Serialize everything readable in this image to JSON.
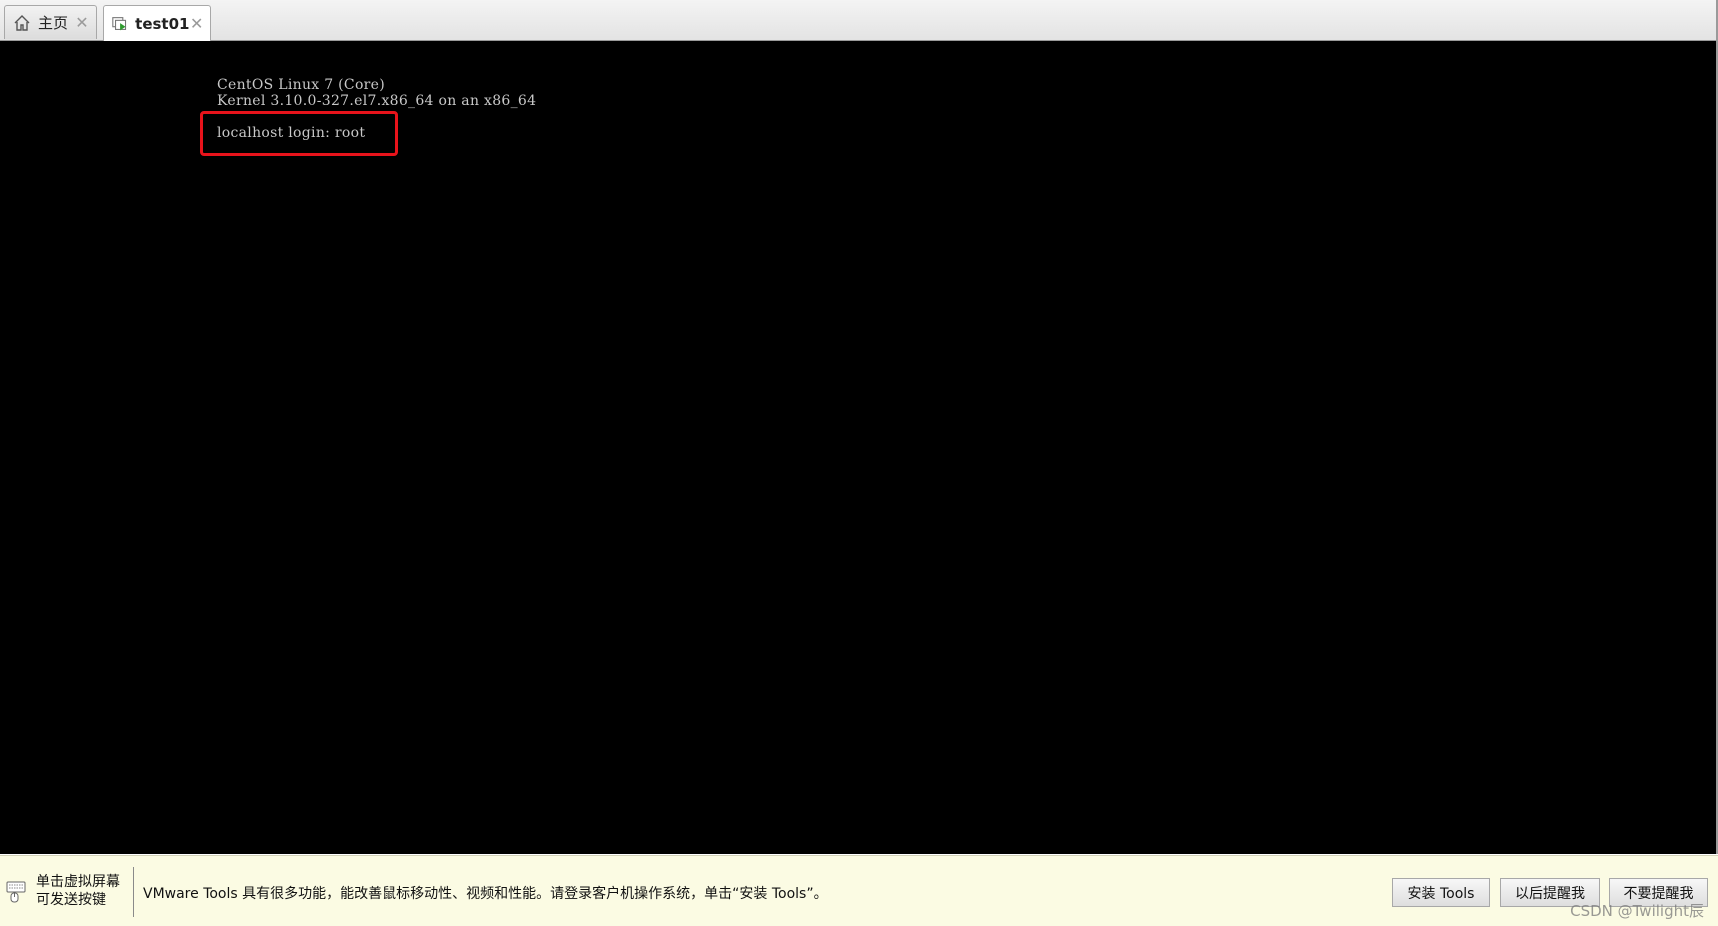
{
  "tabs": [
    {
      "label": "主页",
      "icon": "home-icon",
      "close": "✕"
    },
    {
      "label": "test01",
      "icon": "vm-running-icon",
      "close": "✕"
    }
  ],
  "console": {
    "lines": [
      "CentOS Linux 7 (Core)",
      "Kernel 3.10.0-327.el7.x86_64 on an x86_64",
      "localhost login: root"
    ],
    "highlight_color": "#e8131b",
    "background": "#000000"
  },
  "bottombar": {
    "hint": "单击虚拟屏幕\n可发送按键",
    "message": "VMware Tools 具有很多功能，能改善鼠标移动性、视频和性能。请登录客户机操作系统，单击“安装 Tools”。",
    "buttons": {
      "install": "安装 Tools",
      "later": "以后提醒我",
      "never": "不要提醒我"
    },
    "watermark": "CSDN @Twilight辰"
  }
}
